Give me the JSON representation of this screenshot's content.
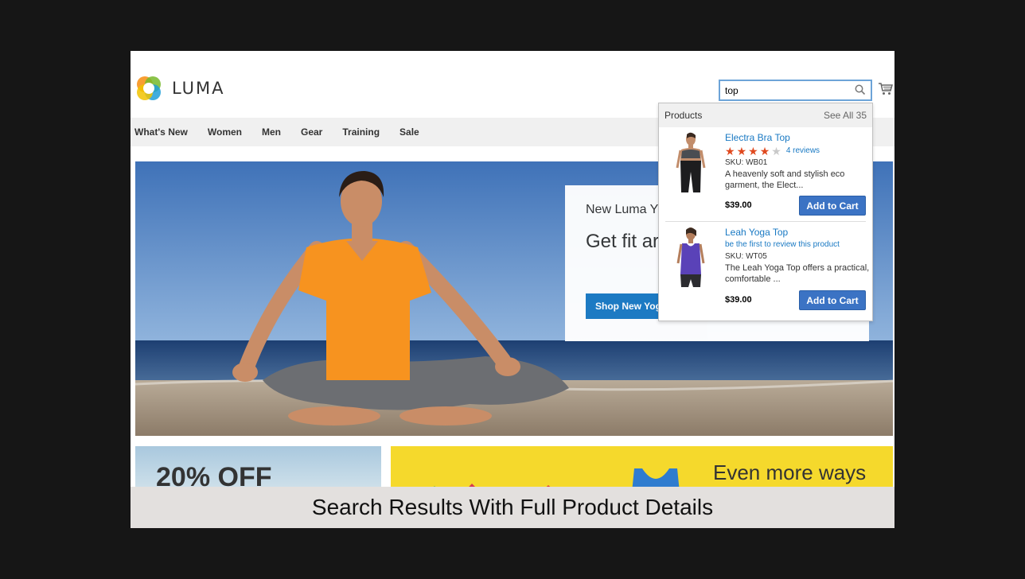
{
  "brand": {
    "name": "LUMA"
  },
  "search": {
    "value": "top"
  },
  "nav": {
    "items": [
      "What's New",
      "Women",
      "Men",
      "Gear",
      "Training",
      "Sale"
    ]
  },
  "hero": {
    "kicker": "New Luma Y",
    "title": "Get fit ar seasona",
    "button": "Shop New Yoga"
  },
  "autocomplete": {
    "heading": "Products",
    "see_all": "See All 35",
    "products": [
      {
        "name": "Electra Bra Top",
        "rating_stars": 3.5,
        "reviews": "4 reviews",
        "sku": "SKU: WB01",
        "desc": "A heavenly soft and stylish eco garment, the Elect...",
        "price": "$39.00",
        "cart_label": "Add to Cart"
      },
      {
        "name": "Leah Yoga Top",
        "review_prompt": "be the first to review this product",
        "sku": "SKU: WT05",
        "desc": "The Leah Yoga Top offers a practical, comfortable ...",
        "price": "$39.00",
        "cart_label": "Add to Cart"
      }
    ]
  },
  "promos": {
    "left": "20% OFF",
    "right": "Even more ways"
  },
  "caption": "Search Results With Full Product Details",
  "colors": {
    "accent": "#1979c3",
    "star": "#e0491f",
    "promo_yellow": "#f5d92c"
  }
}
